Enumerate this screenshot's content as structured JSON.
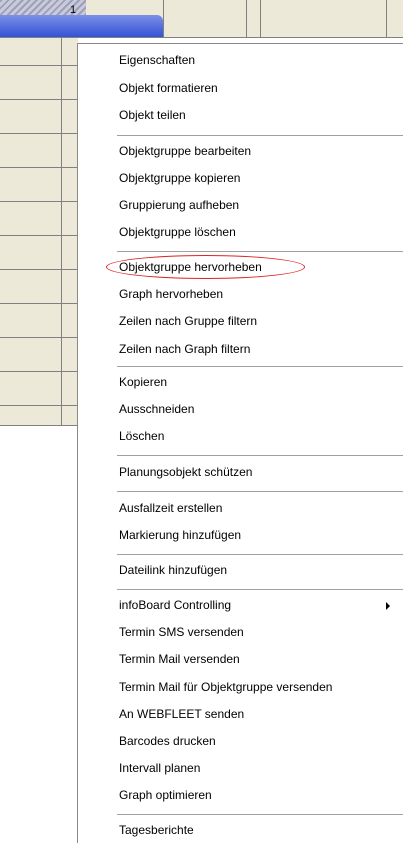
{
  "header": {
    "cell_number": "1"
  },
  "menu": {
    "items": [
      "Eigenschaften",
      "Objekt formatieren",
      "Objekt teilen",
      "Objektgruppe bearbeiten",
      "Objektgruppe kopieren",
      "Gruppierung aufheben",
      "Objektgruppe löschen",
      "Objektgruppe hervorheben",
      "Graph hervorheben",
      "Zeilen nach Gruppe filtern",
      "Zeilen nach Graph filtern",
      "Kopieren",
      "Ausschneiden",
      "Löschen",
      "Planungsobjekt schützen",
      "Ausfallzeit erstellen",
      "Markierung hinzufügen",
      "Dateilink hinzufügen",
      "infoBoard Controlling",
      "Termin SMS versenden",
      "Termin Mail versenden",
      "Termin Mail für Objektgruppe versenden",
      "An WEBFLEET senden",
      "Barcodes drucken",
      "Intervall planen",
      "Graph optimieren",
      "Tagesberichte"
    ]
  },
  "colors": {
    "bar_top": "#7c8fe6",
    "bar_bottom": "#3352d6",
    "highlight_ring": "#dd2222"
  }
}
